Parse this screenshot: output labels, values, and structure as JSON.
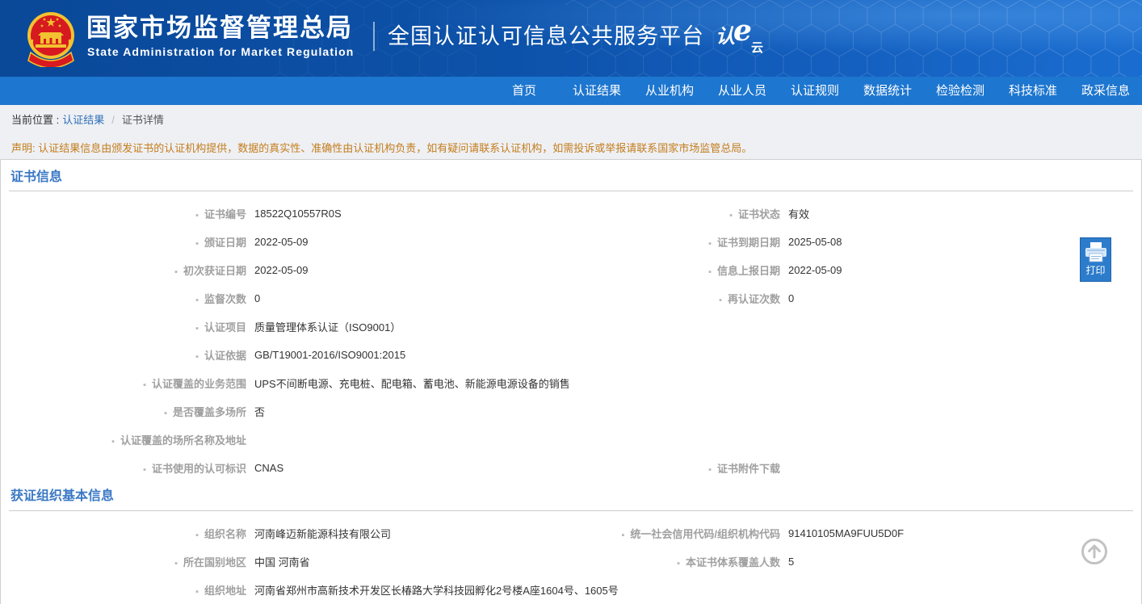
{
  "header": {
    "org_name_cn": "国家市场监督管理总局",
    "org_name_en": "State Administration for Market Regulation",
    "platform_title": "全国认证认可信息公共服务平台",
    "logo": {
      "char1": "认",
      "char2": "e",
      "char3": "云"
    },
    "emblem_icon": "national-emblem-icon"
  },
  "nav": {
    "items": [
      "首页",
      "认证结果",
      "从业机构",
      "从业人员",
      "认证规则",
      "数据统计",
      "检验检测",
      "科技标准",
      "政采信息"
    ]
  },
  "breadcrumb": {
    "prefix": "当前位置 :",
    "link": "认证结果",
    "separator": "/",
    "current": "证书详情"
  },
  "disclaimer": "声明: 认证结果信息由颁发证书的认证机构提供，数据的真实性、准确性由认证机构负责，如有疑问请联系认证机构，如需投诉或举报请联系国家市场监管总局。",
  "certificate": {
    "title": "证书信息",
    "rows": [
      {
        "left": {
          "label": "证书编号",
          "value": "18522Q10557R0S"
        },
        "right": {
          "label": "证书状态",
          "value": "有效"
        }
      },
      {
        "left": {
          "label": "颁证日期",
          "value": "2022-05-09"
        },
        "right": {
          "label": "证书到期日期",
          "value": "2025-05-08"
        }
      },
      {
        "left": {
          "label": "初次获证日期",
          "value": "2022-05-09"
        },
        "right": {
          "label": "信息上报日期",
          "value": "2022-05-09"
        }
      },
      {
        "left": {
          "label": "监督次数",
          "value": "0"
        },
        "right": {
          "label": "再认证次数",
          "value": "0"
        }
      },
      {
        "left": {
          "label": "认证项目",
          "value": "质量管理体系认证（ISO9001）"
        }
      },
      {
        "left": {
          "label": "认证依据",
          "value": "GB/T19001-2016/ISO9001:2015"
        }
      },
      {
        "left": {
          "label": "认证覆盖的业务范围",
          "value": "UPS不间断电源、充电桩、配电箱、蓄电池、新能源电源设备的销售"
        }
      },
      {
        "left": {
          "label": "是否覆盖多场所",
          "value": "否"
        }
      },
      {
        "left": {
          "label": "认证覆盖的场所名称及地址",
          "value": ""
        }
      },
      {
        "left": {
          "label": "证书使用的认可标识",
          "value": "CNAS"
        },
        "right": {
          "label": "证书附件下载",
          "value": ""
        }
      }
    ]
  },
  "organization": {
    "title": "获证组织基本信息",
    "rows": [
      {
        "left": {
          "label": "组织名称",
          "value": "河南峰迈新能源科技有限公司"
        },
        "right": {
          "label": "统一社会信用代码/组织机构代码",
          "value": "91410105MA9FUU5D0F"
        }
      },
      {
        "left": {
          "label": "所在国别地区",
          "value": "中国 河南省"
        },
        "right": {
          "label": "本证书体系覆盖人数",
          "value": "5"
        }
      },
      {
        "left": {
          "label": "组织地址",
          "value": "河南省郑州市高新技术开发区长椿路大学科技园孵化2号楼A座1604号、1605号"
        }
      }
    ]
  },
  "print_button": {
    "label": "打印",
    "icon": "printer-icon"
  },
  "scroll_top": {
    "icon": "arrow-up-circle-icon"
  },
  "colors": {
    "header_bg": "#0d52aa",
    "nav_bg": "#1d76cf",
    "section_title": "#3a78c4",
    "label": "#a0a0a0",
    "value": "#333333",
    "disclaimer": "#c47d1c",
    "link": "#2f6fb7",
    "emblem_red": "#d61a1f",
    "emblem_gold": "#f2c230"
  }
}
